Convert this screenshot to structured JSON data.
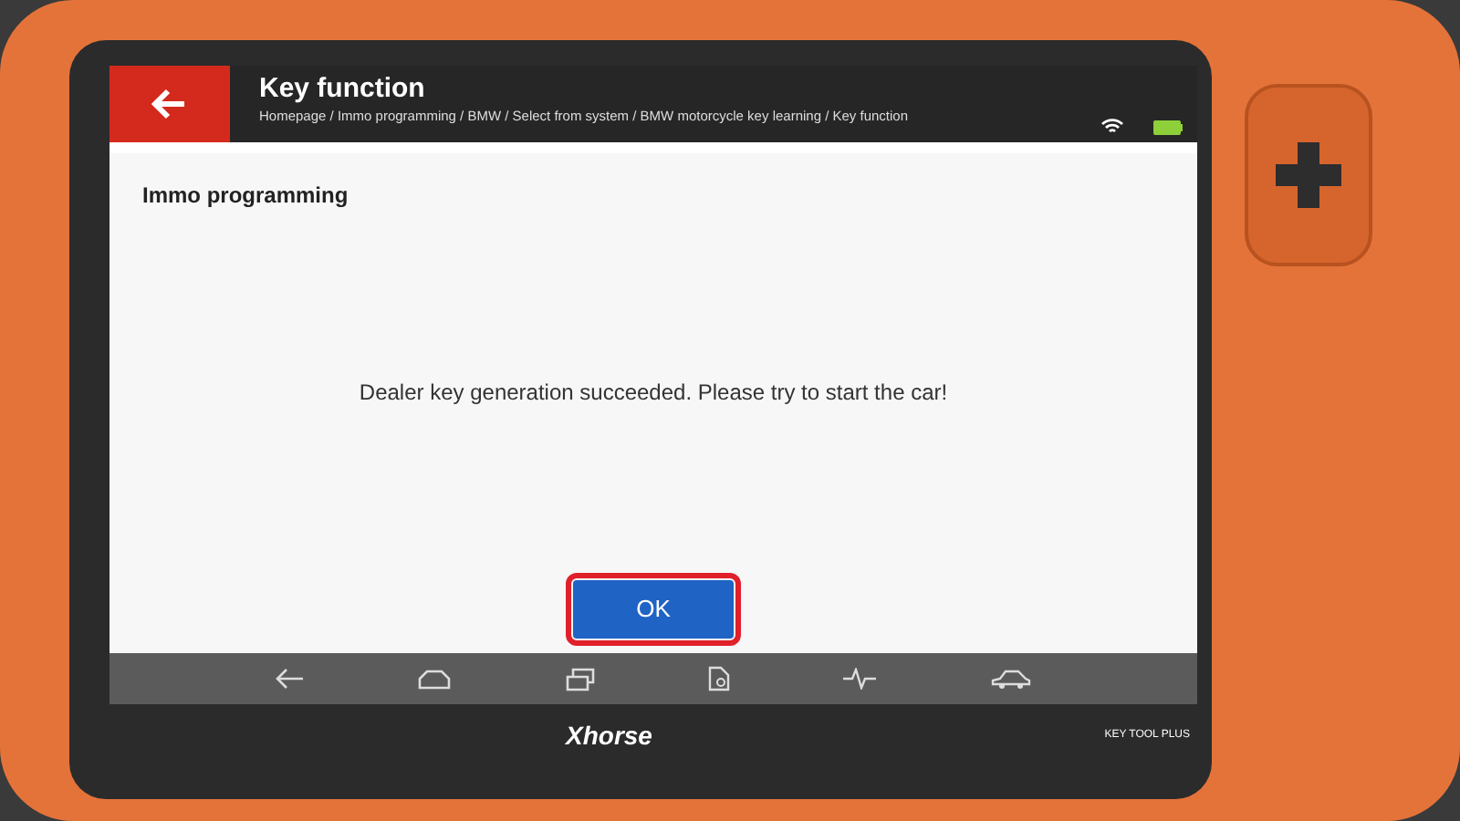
{
  "header": {
    "title": "Key function",
    "breadcrumb": "Homepage / Immo programming / BMW / Select from  system / BMW motorcycle key learning / Key function"
  },
  "dialog": {
    "title": "Immo programming",
    "message": "Dealer key generation succeeded. Please try to start the car!",
    "button": {
      "label": "OK",
      "focused": true
    }
  },
  "bezel": {
    "logo": "Xhorse",
    "model": "KEY TOOL PLUS"
  }
}
